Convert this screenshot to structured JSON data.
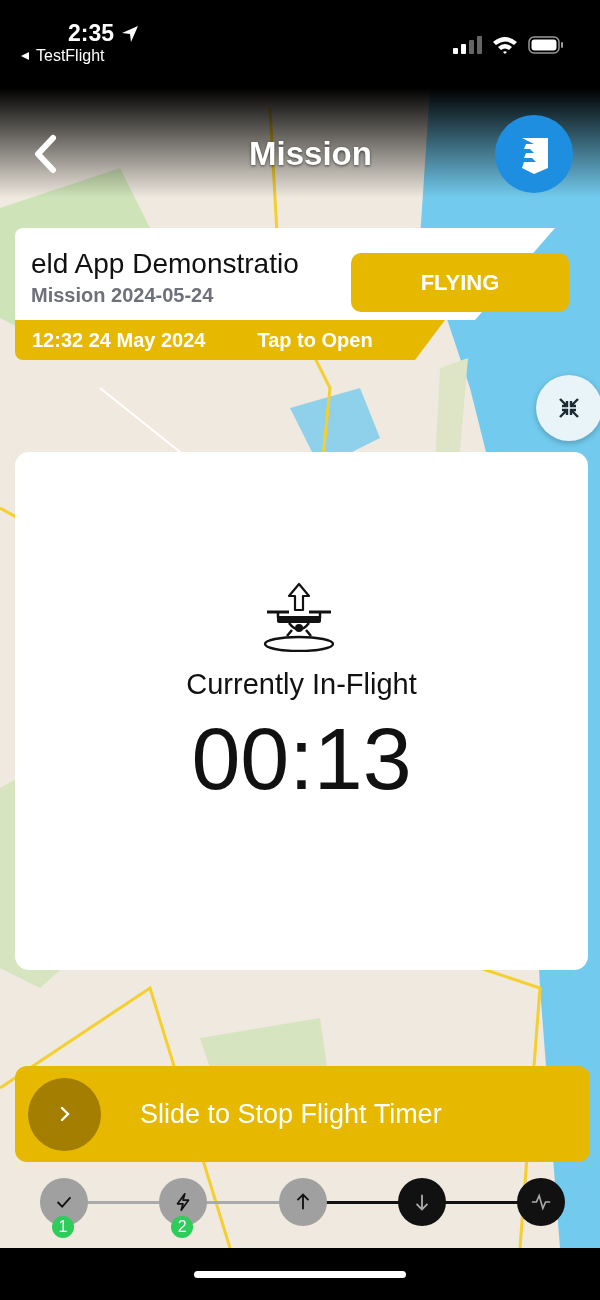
{
  "status_bar": {
    "time": "2:35",
    "back_app": "TestFlight"
  },
  "header": {
    "title": "Mission"
  },
  "mission_card": {
    "name": "eld App Demonstratio",
    "subtitle": "Mission 2024-05-24",
    "status": "FLYING",
    "date": "12:32 24 May 2024",
    "action": "Tap to Open"
  },
  "flight_panel": {
    "label": "Currently In-Flight",
    "timer": "00:13"
  },
  "slider": {
    "label": "Slide to Stop Flight Timer",
    "level": 0
  },
  "steps": [
    {
      "kind": "check",
      "completed": true,
      "badge": "1"
    },
    {
      "kind": "bolt",
      "completed": true,
      "badge": "2"
    },
    {
      "kind": "up",
      "completed": true
    },
    {
      "kind": "down",
      "completed": false
    },
    {
      "kind": "pulse",
      "completed": false
    }
  ]
}
